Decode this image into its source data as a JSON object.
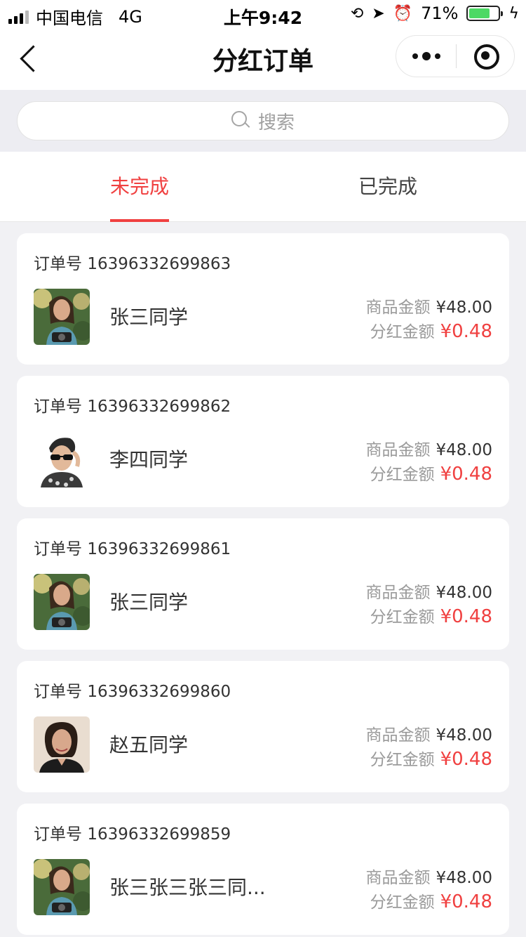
{
  "status_bar": {
    "carrier": "中国电信",
    "network": "4G",
    "time": "上午9:42",
    "battery": "71%"
  },
  "nav": {
    "title": "分红订单"
  },
  "search": {
    "placeholder": "搜索"
  },
  "tabs": [
    {
      "label": "未完成",
      "active": true
    },
    {
      "label": "已完成",
      "active": false
    }
  ],
  "orders": [
    {
      "order_label": "订单号",
      "order_no": "16396332699863",
      "name": "张三同学",
      "goods_label": "商品金额",
      "goods_amount": "¥48.00",
      "dividend_label": "分红金额",
      "dividend_amount": "¥0.48",
      "avatar": "avatar-girl-photo"
    },
    {
      "order_label": "订单号",
      "order_no": "16396332699862",
      "name": "李四同学",
      "goods_label": "商品金额",
      "goods_amount": "¥48.00",
      "dividend_label": "分红金额",
      "dividend_amount": "¥0.48",
      "avatar": "avatar-man-sunglasses"
    },
    {
      "order_label": "订单号",
      "order_no": "16396332699861",
      "name": "张三同学",
      "goods_label": "商品金额",
      "goods_amount": "¥48.00",
      "dividend_label": "分红金额",
      "dividend_amount": "¥0.48",
      "avatar": "avatar-girl-photo"
    },
    {
      "order_label": "订单号",
      "order_no": "16396332699860",
      "name": "赵五同学",
      "goods_label": "商品金额",
      "goods_amount": "¥48.00",
      "dividend_label": "分红金额",
      "dividend_amount": "¥0.48",
      "avatar": "avatar-woman-portrait"
    },
    {
      "order_label": "订单号",
      "order_no": "16396332699859",
      "name": "张三张三张三同...",
      "goods_label": "商品金额",
      "goods_amount": "¥48.00",
      "dividend_label": "分红金额",
      "dividend_amount": "¥0.48",
      "avatar": "avatar-girl-photo"
    }
  ],
  "colors": {
    "accent": "#f04040",
    "page_bg": "#f1f1f4",
    "battery": "#4cd964"
  }
}
